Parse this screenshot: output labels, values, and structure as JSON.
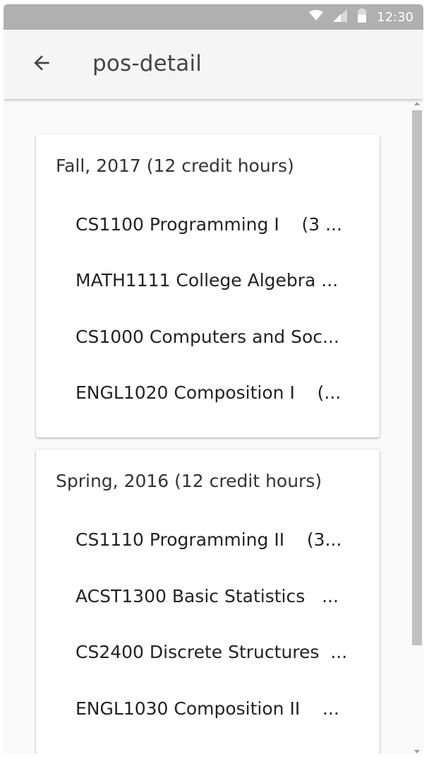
{
  "status_bar": {
    "time": "12:30",
    "icons": [
      "wifi-icon",
      "signal-icon",
      "battery-icon"
    ]
  },
  "app_bar": {
    "back_icon": "arrow-left-icon",
    "title": "pos-detail"
  },
  "semesters": [
    {
      "title": "Fall, 2017 (12 credit hours)",
      "courses": [
        "CS1100 Programming I    (3 ...",
        "MATH1111 College Algebra ...",
        "CS1000 Computers and Soc...",
        "ENGL1020 Composition I    (..."
      ]
    },
    {
      "title": "Spring, 2016 (12 credit hours)",
      "courses": [
        "CS1110 Programming II    (3...",
        "ACST1300 Basic Statistics   ...",
        "CS2400 Discrete Structures  ...",
        "ENGL1030 Composition II    ..."
      ]
    }
  ],
  "colors": {
    "status_bar": "#b0b0b0",
    "app_bar": "#f5f5f5",
    "background": "#fafafa",
    "card": "#ffffff"
  }
}
